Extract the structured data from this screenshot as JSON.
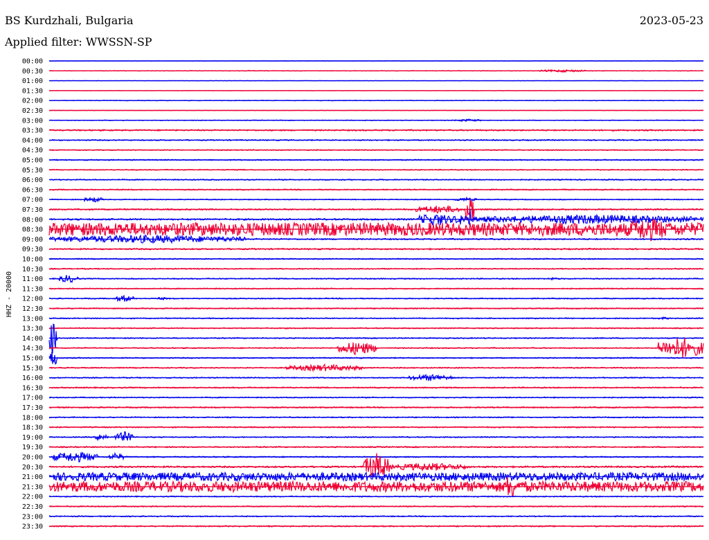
{
  "header": {
    "station": "BS Kurdzhali, Bulgaria",
    "date": "2023-05-23",
    "filter": "Applied filter: WWSSN-SP"
  },
  "chart_data": {
    "type": "line",
    "title": "BS Kurdzhali, Bulgaria",
    "ylabel": "HHZ - 20000",
    "colors": {
      "even": "#0000ee",
      "odd": "#ee0033"
    },
    "rows": [
      {
        "label": "00:00",
        "noise": 0.3,
        "events": []
      },
      {
        "label": "00:30",
        "noise": 0.4,
        "events": [
          {
            "start": 0.75,
            "end": 0.82,
            "amp": 2
          }
        ]
      },
      {
        "label": "01:00",
        "noise": 0.3,
        "events": []
      },
      {
        "label": "01:30",
        "noise": 0.3,
        "events": []
      },
      {
        "label": "02:00",
        "noise": 0.5,
        "events": []
      },
      {
        "label": "02:30",
        "noise": 0.3,
        "events": []
      },
      {
        "label": "03:00",
        "noise": 0.5,
        "events": [
          {
            "start": 0.62,
            "end": 0.66,
            "amp": 2
          }
        ]
      },
      {
        "label": "03:30",
        "noise": 1.0,
        "events": []
      },
      {
        "label": "04:00",
        "noise": 0.8,
        "events": []
      },
      {
        "label": "04:30",
        "noise": 0.7,
        "events": []
      },
      {
        "label": "05:00",
        "noise": 0.8,
        "events": []
      },
      {
        "label": "05:30",
        "noise": 0.7,
        "events": []
      },
      {
        "label": "06:00",
        "noise": 0.8,
        "events": []
      },
      {
        "label": "06:30",
        "noise": 0.8,
        "events": []
      },
      {
        "label": "07:00",
        "noise": 0.7,
        "events": [
          {
            "start": 0.053,
            "end": 0.083,
            "amp": 4
          },
          {
            "start": 0.62,
            "end": 0.655,
            "amp": 3
          }
        ]
      },
      {
        "label": "07:30",
        "noise": 1.0,
        "events": [
          {
            "start": 0.56,
            "end": 0.63,
            "amp": 6
          },
          {
            "start": 0.635,
            "end": 0.65,
            "amp": 26
          }
        ]
      },
      {
        "label": "08:00",
        "noise": 1.2,
        "events": [
          {
            "start": 0.565,
            "end": 0.615,
            "amp": 10
          },
          {
            "start": 0.615,
            "end": 0.645,
            "amp": 8
          },
          {
            "start": 0.64,
            "end": 0.645,
            "amp": 20
          },
          {
            "start": 0.645,
            "end": 1.0,
            "amp": 7
          }
        ]
      },
      {
        "label": "08:30",
        "noise": 9.5,
        "events": [
          {
            "start": 0.88,
            "end": 0.95,
            "amp": 18
          }
        ]
      },
      {
        "label": "09:00",
        "noise": 1.0,
        "events": [
          {
            "start": 0.0,
            "end": 0.3,
            "amp": 6
          }
        ]
      },
      {
        "label": "09:30",
        "noise": 1.0,
        "events": []
      },
      {
        "label": "10:00",
        "noise": 0.8,
        "events": []
      },
      {
        "label": "10:30",
        "noise": 0.8,
        "events": []
      },
      {
        "label": "11:00",
        "noise": 0.8,
        "events": [
          {
            "start": 0.015,
            "end": 0.045,
            "amp": 6
          },
          {
            "start": 0.76,
            "end": 0.78,
            "amp": 2
          }
        ]
      },
      {
        "label": "11:30",
        "noise": 0.8,
        "events": []
      },
      {
        "label": "12:00",
        "noise": 0.8,
        "events": [
          {
            "start": 0.1,
            "end": 0.13,
            "amp": 5
          },
          {
            "start": 0.16,
            "end": 0.185,
            "amp": 2
          }
        ]
      },
      {
        "label": "12:30",
        "noise": 0.8,
        "events": []
      },
      {
        "label": "13:00",
        "noise": 0.8,
        "events": [
          {
            "start": 0.93,
            "end": 0.95,
            "amp": 2
          }
        ]
      },
      {
        "label": "13:30",
        "noise": 0.8,
        "events": []
      },
      {
        "label": "14:00",
        "noise": 0.8,
        "events": [
          {
            "start": 0.0,
            "end": 0.012,
            "amp": 28
          }
        ]
      },
      {
        "label": "14:30",
        "noise": 0.8,
        "events": [
          {
            "start": 0.44,
            "end": 0.5,
            "amp": 10
          },
          {
            "start": 0.93,
            "end": 1.0,
            "amp": 16
          }
        ]
      },
      {
        "label": "15:00",
        "noise": 0.8,
        "events": [
          {
            "start": 0.0,
            "end": 0.012,
            "amp": 14
          }
        ]
      },
      {
        "label": "15:30",
        "noise": 0.8,
        "events": [
          {
            "start": 0.36,
            "end": 0.48,
            "amp": 5
          }
        ]
      },
      {
        "label": "16:00",
        "noise": 0.8,
        "events": [
          {
            "start": 0.55,
            "end": 0.62,
            "amp": 5
          }
        ]
      },
      {
        "label": "16:30",
        "noise": 0.9,
        "events": []
      },
      {
        "label": "17:00",
        "noise": 0.8,
        "events": []
      },
      {
        "label": "17:30",
        "noise": 0.9,
        "events": []
      },
      {
        "label": "18:00",
        "noise": 0.8,
        "events": []
      },
      {
        "label": "18:30",
        "noise": 0.9,
        "events": []
      },
      {
        "label": "19:00",
        "noise": 0.8,
        "events": [
          {
            "start": 0.07,
            "end": 0.09,
            "amp": 6
          },
          {
            "start": 0.1,
            "end": 0.13,
            "amp": 8
          }
        ]
      },
      {
        "label": "19:30",
        "noise": 0.9,
        "events": []
      },
      {
        "label": "20:00",
        "noise": 0.9,
        "events": [
          {
            "start": 0.005,
            "end": 0.075,
            "amp": 8
          },
          {
            "start": 0.09,
            "end": 0.115,
            "amp": 6
          }
        ]
      },
      {
        "label": "20:30",
        "noise": 1.2,
        "events": [
          {
            "start": 0.48,
            "end": 0.52,
            "amp": 20
          },
          {
            "start": 0.52,
            "end": 0.64,
            "amp": 6
          }
        ]
      },
      {
        "label": "21:00",
        "noise": 6.0,
        "events": []
      },
      {
        "label": "21:30",
        "noise": 7.5,
        "events": [
          {
            "start": 0.7,
            "end": 0.71,
            "amp": 28
          }
        ]
      },
      {
        "label": "22:00",
        "noise": 0.8,
        "events": []
      },
      {
        "label": "22:30",
        "noise": 0.8,
        "events": []
      },
      {
        "label": "23:00",
        "noise": 0.8,
        "events": []
      },
      {
        "label": "23:30",
        "noise": 0.9,
        "events": []
      }
    ]
  }
}
